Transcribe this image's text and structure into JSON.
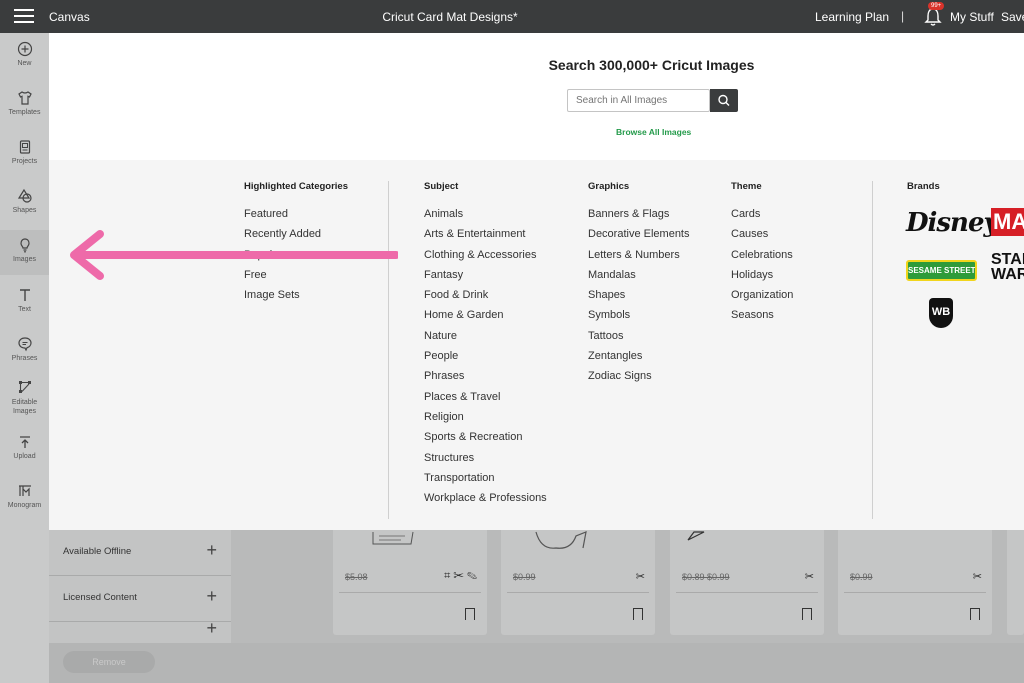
{
  "topbar": {
    "app_name": "Canvas",
    "project_title": "Cricut Card Mat Designs*",
    "learning_plan": "Learning Plan",
    "separator": "|",
    "notification_badge": "99+",
    "my_stuff": "My Stuff",
    "save": "Save"
  },
  "sidebar": {
    "items": [
      {
        "label": "New",
        "icon": "plus-circle-icon"
      },
      {
        "label": "Templates",
        "icon": "shirt-icon"
      },
      {
        "label": "Projects",
        "icon": "projects-icon"
      },
      {
        "label": "Shapes",
        "icon": "shapes-icon"
      },
      {
        "label": "Images",
        "icon": "bulb-icon"
      },
      {
        "label": "Text",
        "icon": "text-icon"
      },
      {
        "label": "Phrases",
        "icon": "speech-bubble-icon"
      },
      {
        "label": "Editable Images",
        "icon": "edit-nodes-icon"
      },
      {
        "label": "Upload",
        "icon": "upload-icon"
      },
      {
        "label": "Monogram",
        "icon": "monogram-icon"
      }
    ]
  },
  "search": {
    "title": "Search 300,000+ Cricut Images",
    "placeholder": "Search in All Images",
    "browse_all": "Browse All Images"
  },
  "categories": {
    "highlighted": {
      "heading": "Highlighted Categories",
      "items": [
        "Featured",
        "Recently Added",
        "Popular",
        "Free",
        "Image Sets"
      ]
    },
    "subject": {
      "heading": "Subject",
      "items": [
        "Animals",
        "Arts & Entertainment",
        "Clothing & Accessories",
        "Fantasy",
        "Food & Drink",
        "Home & Garden",
        "Nature",
        "People",
        "Phrases",
        "Places & Travel",
        "Religion",
        "Sports & Recreation",
        "Structures",
        "Transportation",
        "Workplace & Professions"
      ]
    },
    "graphics": {
      "heading": "Graphics",
      "items": [
        "Banners & Flags",
        "Decorative Elements",
        "Letters & Numbers",
        "Mandalas",
        "Shapes",
        "Symbols",
        "Tattoos",
        "Zentangles",
        "Zodiac Signs"
      ]
    },
    "theme": {
      "heading": "Theme",
      "items": [
        "Cards",
        "Causes",
        "Celebrations",
        "Holidays",
        "Organization",
        "Seasons"
      ]
    },
    "brands": {
      "heading": "Brands",
      "items": [
        "Disney",
        "MARVEL",
        "SESAME STREET",
        "STAR WARS",
        "WB"
      ]
    }
  },
  "filters": {
    "available_offline": "Available Offline",
    "licensed_content": "Licensed Content"
  },
  "cards": [
    {
      "price": "$5.08"
    },
    {
      "price": "$0.99"
    },
    {
      "price": "$0.89 $0.99"
    },
    {
      "price": "$0.99"
    }
  ],
  "bottom": {
    "remove": "Remove"
  },
  "colors": {
    "accent_green": "#239a4a",
    "topbar": "#3a3c3d",
    "arrow_pink": "#ee6aa9"
  }
}
